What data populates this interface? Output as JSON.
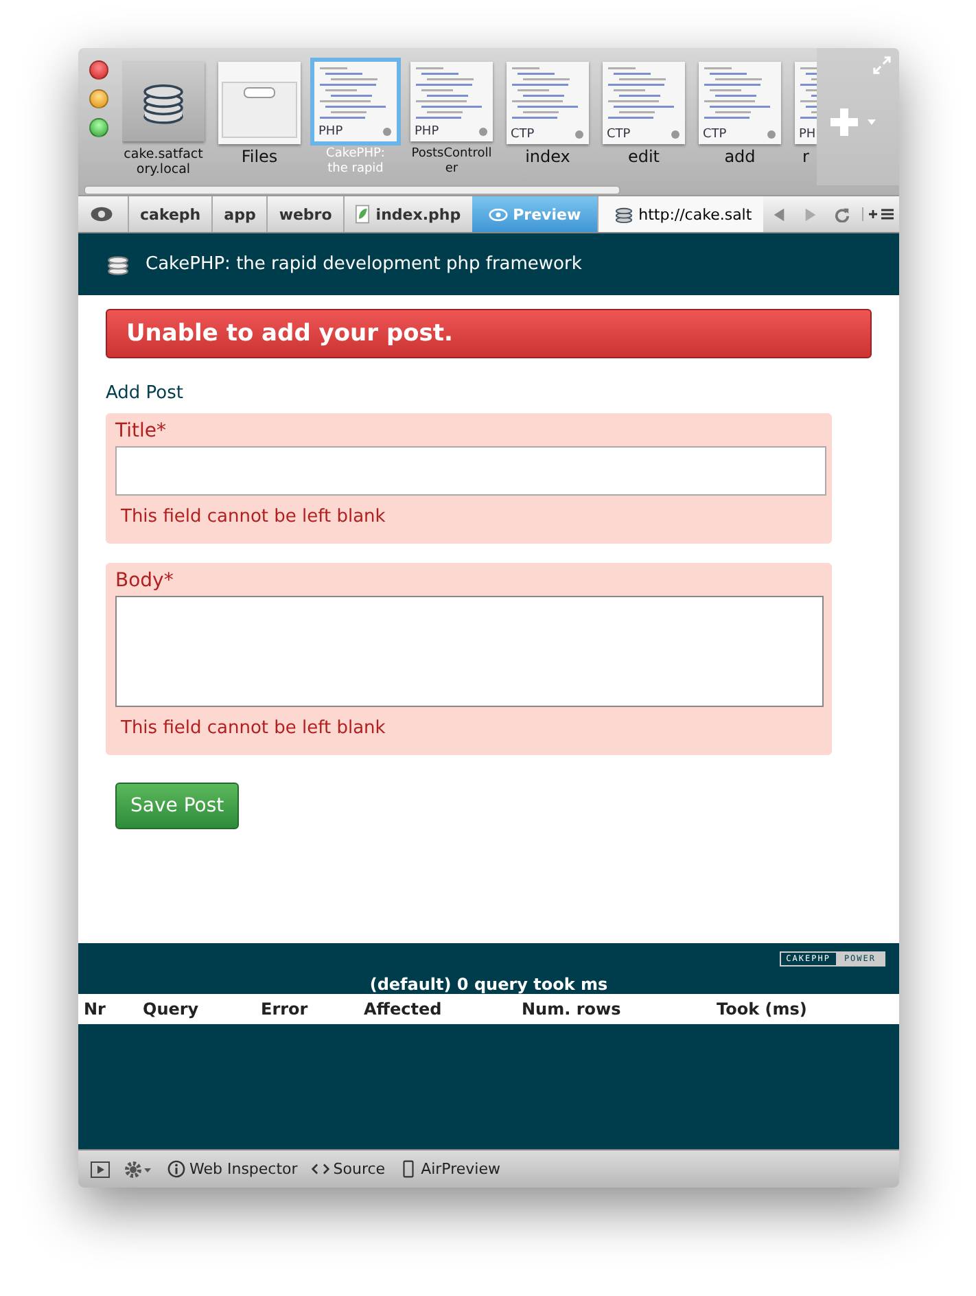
{
  "tab_strip": {
    "tabs": [
      {
        "label": "cake.satfactory.local",
        "kind": "site",
        "selected": false
      },
      {
        "label": "Files",
        "kind": "files",
        "selected": false
      },
      {
        "label": "CakePHP: the rapid",
        "kind": "doc",
        "tag": "PHP",
        "selected": true
      },
      {
        "label": "PostsController",
        "kind": "doc",
        "tag": "PHP",
        "selected": false
      },
      {
        "label": "index",
        "kind": "doc",
        "tag": "CTP",
        "selected": false
      },
      {
        "label": "edit",
        "kind": "doc",
        "tag": "CTP",
        "selected": false
      },
      {
        "label": "add",
        "kind": "doc",
        "tag": "CTP",
        "selected": false
      },
      {
        "label": "r",
        "kind": "doc",
        "tag": "PH",
        "selected": false
      }
    ]
  },
  "path_bar": {
    "crumbs": [
      {
        "label": "cakeph",
        "kind": "folder"
      },
      {
        "label": "app",
        "kind": "folder"
      },
      {
        "label": "webro",
        "kind": "folder"
      },
      {
        "label": "index.php",
        "kind": "file"
      }
    ],
    "preview": {
      "label": "Preview",
      "selected": true
    },
    "url": "http://cake.salt"
  },
  "page": {
    "header": "CakePHP: the rapid development php framework",
    "flash": "Unable to add your post.",
    "form_title": "Add Post",
    "fields": [
      {
        "label": "Title*",
        "kind": "text",
        "error": "This field cannot be left blank"
      },
      {
        "label": "Body*",
        "kind": "textarea",
        "error": "This field cannot be left blank"
      }
    ],
    "submit": "Save Post"
  },
  "footer": {
    "badge": [
      "CAKEPHP",
      "POWER"
    ],
    "sql_caption": "(default) 0 query took ms",
    "columns": [
      "Nr",
      "Query",
      "Error",
      "Affected",
      "Num. rows",
      "Took (ms)"
    ]
  },
  "bottom_bar": {
    "items": [
      {
        "label": "Web Inspector",
        "kind": "info"
      },
      {
        "label": "Source",
        "kind": "source"
      },
      {
        "label": "AirPreview",
        "kind": "device"
      }
    ]
  }
}
